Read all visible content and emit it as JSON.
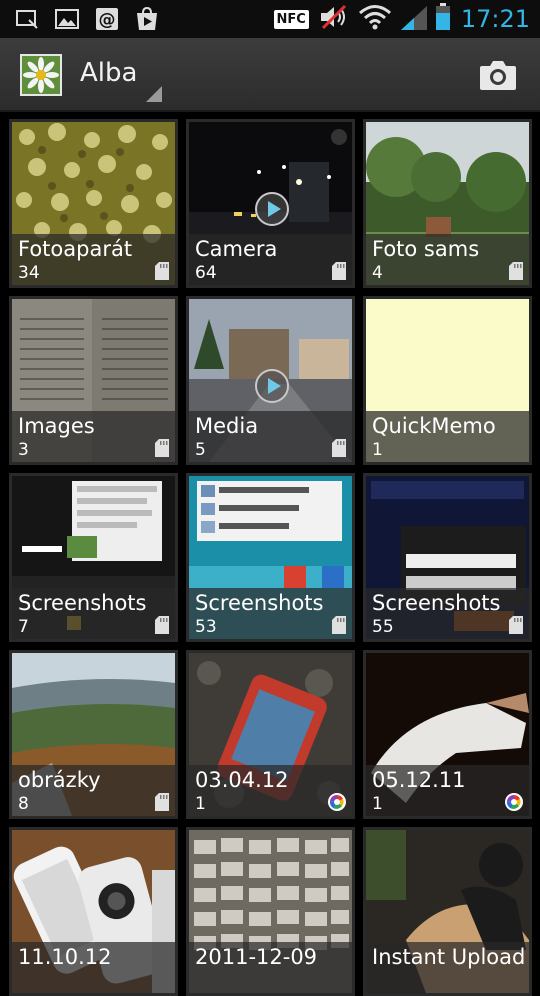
{
  "status_bar": {
    "left_icons": [
      "screenshot-icon",
      "image-icon",
      "email-at-icon",
      "play-store-icon"
    ],
    "nfc_label": "NFC",
    "right_icons": [
      "mute-icon",
      "wifi-icon",
      "signal-icon",
      "battery-icon"
    ],
    "time": "17:21",
    "accent_color": "#33b5e5"
  },
  "action_bar": {
    "album_name": "Alba",
    "thumbnail_icon": "daisy-icon",
    "camera_icon": "camera-icon"
  },
  "albums": [
    {
      "title": "Fotoaparát",
      "count": "34",
      "source_icon": "sd-card-icon",
      "has_play": false
    },
    {
      "title": "Camera",
      "count": "64",
      "source_icon": "sd-card-icon",
      "has_play": true
    },
    {
      "title": "Foto sams",
      "count": "4",
      "source_icon": "sd-card-icon",
      "has_play": false
    },
    {
      "title": "Images",
      "count": "3",
      "source_icon": "sd-card-icon",
      "has_play": false
    },
    {
      "title": "Media",
      "count": "5",
      "source_icon": "sd-card-icon",
      "has_play": true
    },
    {
      "title": "QuickMemo",
      "count": "1",
      "source_icon": "",
      "has_play": false
    },
    {
      "title": "Screenshots",
      "count": "7",
      "source_icon": "sd-card-icon",
      "has_play": false
    },
    {
      "title": "Screenshots",
      "count": "53",
      "source_icon": "sd-card-icon",
      "has_play": false
    },
    {
      "title": "Screenshots",
      "count": "55",
      "source_icon": "sd-card-icon",
      "has_play": false
    },
    {
      "title": "obrázky",
      "count": "8",
      "source_icon": "sd-card-icon",
      "has_play": false
    },
    {
      "title": "03.04.12",
      "count": "1",
      "source_icon": "picasa-icon",
      "has_play": false
    },
    {
      "title": "05.12.11",
      "count": "1",
      "source_icon": "picasa-icon",
      "has_play": false
    },
    {
      "title": "11.10.12",
      "count": "",
      "source_icon": "",
      "has_play": false
    },
    {
      "title": "2011-12-09",
      "count": "",
      "source_icon": "",
      "has_play": false
    },
    {
      "title": "Instant Upload",
      "count": "",
      "source_icon": "",
      "has_play": false
    }
  ]
}
